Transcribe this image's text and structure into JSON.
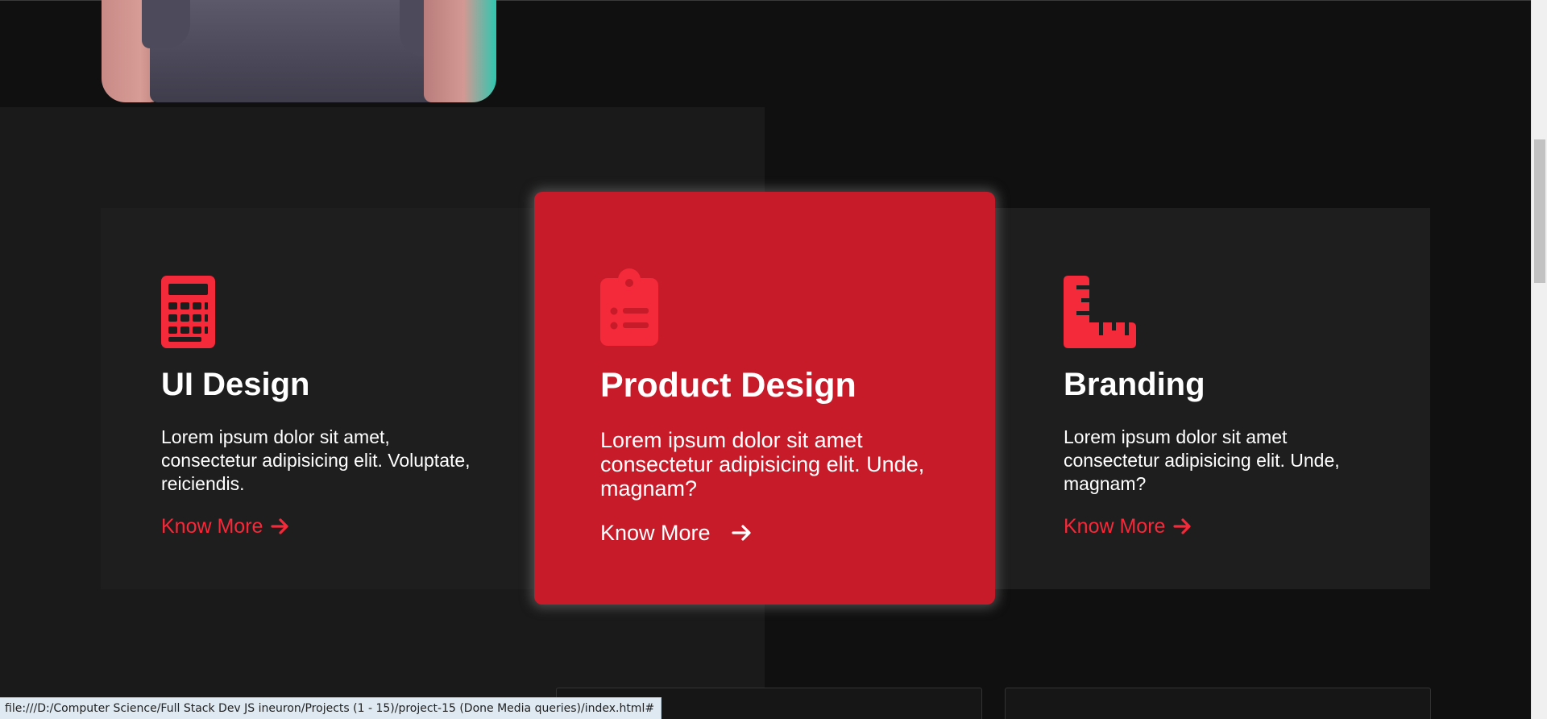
{
  "cards": [
    {
      "icon": "calculator-icon",
      "title": "UI Design",
      "description": "Lorem ipsum dolor sit amet, consectetur adipisicing elit. Voluptate, reiciendis.",
      "link": "Know More"
    },
    {
      "icon": "clipboard-list-icon",
      "title": "Product Design",
      "description": "Lorem ipsum dolor sit amet consectetur adipisicing elit. Unde, magnam?",
      "link": "Know More"
    },
    {
      "icon": "ruler-combined-icon",
      "title": "Branding",
      "description": "Lorem ipsum dolor sit amet consectetur adipisicing elit. Unde, magnam?",
      "link": "Know More"
    }
  ],
  "status_bar": {
    "url": "file:///D:/Computer Science/Full Stack Dev JS ineuron/Projects (1 - 15)/project-15 (Done Media queries)/index.html#"
  },
  "colors": {
    "accent": "#f4293a",
    "featured_bg": "#c81b29",
    "page_bg": "#101010",
    "card_bg": "#1e1e1e"
  }
}
